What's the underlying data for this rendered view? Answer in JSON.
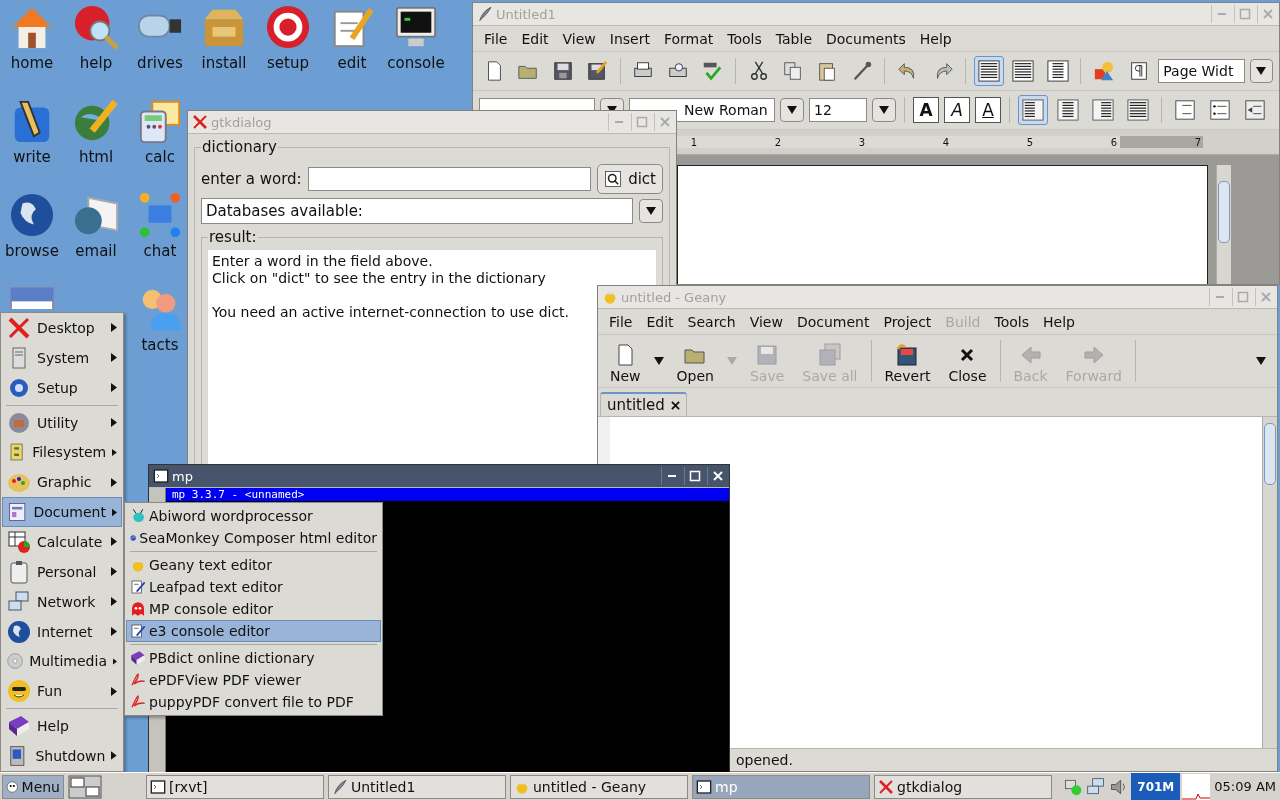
{
  "desktop": {
    "rows": [
      [
        {
          "label": "home",
          "kind": "house"
        },
        {
          "label": "help",
          "kind": "help"
        },
        {
          "label": "drives",
          "kind": "usb"
        },
        {
          "label": "install",
          "kind": "package"
        },
        {
          "label": "setup",
          "kind": "setup"
        },
        {
          "label": "edit",
          "kind": "notepad"
        },
        {
          "label": "console",
          "kind": "monitor"
        }
      ],
      [
        {
          "label": "write",
          "kind": "pen"
        },
        {
          "label": "html",
          "kind": "globe-pencil"
        },
        {
          "label": "calc",
          "kind": "calculator"
        }
      ],
      [
        {
          "label": "browse",
          "kind": "globe"
        },
        {
          "label": "email",
          "kind": "envelope"
        },
        {
          "label": "chat",
          "kind": "chat"
        }
      ],
      [
        {
          "kind": "calendar"
        },
        {},
        {
          "label": "tacts",
          "kind": "people"
        }
      ]
    ]
  },
  "abiword": {
    "title": "Untitled1",
    "active": false,
    "menus": [
      "File",
      "Edit",
      "View",
      "Insert",
      "Format",
      "Tools",
      "Table",
      "Documents",
      "Help"
    ],
    "zoom": "Page Widt",
    "font": "New Roman",
    "size": "12",
    "styles": [
      {
        "label": "A",
        "kind": "bold"
      },
      {
        "label": "A",
        "kind": "italic"
      },
      {
        "label": "A",
        "kind": "underline"
      }
    ],
    "view_modes": [
      {
        "selected": true
      },
      {
        "selected": false
      },
      {
        "selected": false
      }
    ],
    "alignments": [
      {
        "selected": true
      },
      {
        "selected": false
      },
      {
        "selected": false
      },
      {
        "selected": false
      }
    ],
    "ruler": [
      "1",
      "2",
      "3",
      "4",
      "5",
      "6",
      "7"
    ]
  },
  "dialog": {
    "title": "gtkdialog",
    "active": false,
    "frame": "dictionary",
    "word_label": "enter a word:",
    "button": "dict",
    "databases": "Databases available:",
    "result_label": "result:",
    "result_text": "Enter a word in the field above.\nClick on \"dict\" to see the entry in the dictionary\n\nYou need an active internet-connection to use dict."
  },
  "geany": {
    "title": "untitled - Geany",
    "active": false,
    "menus": [
      {
        "label": "File",
        "disabled": false
      },
      {
        "label": "Edit",
        "disabled": false
      },
      {
        "label": "Search",
        "disabled": false
      },
      {
        "label": "View",
        "disabled": false
      },
      {
        "label": "Document",
        "disabled": false
      },
      {
        "label": "Project",
        "disabled": false
      },
      {
        "label": "Build",
        "disabled": true
      },
      {
        "label": "Tools",
        "disabled": false
      },
      {
        "label": "Help",
        "disabled": false
      }
    ],
    "toolbar": [
      [
        {
          "label": "New",
          "kind": "new",
          "disabled": false,
          "dropdown": true,
          "dropdown_disabled": false
        },
        {
          "label": "Open",
          "kind": "open",
          "disabled": false,
          "dropdown": true,
          "dropdown_disabled": true
        },
        {
          "label": "Save",
          "kind": "save",
          "disabled": true
        },
        {
          "label": "Save all",
          "kind": "save-all",
          "disabled": true
        }
      ],
      [
        {
          "label": "Revert",
          "kind": "revert",
          "disabled": false
        },
        {
          "label": "Close",
          "kind": "close",
          "disabled": false
        }
      ],
      [
        {
          "label": "Back",
          "kind": "back",
          "disabled": true
        },
        {
          "label": "Forward",
          "kind": "forward",
          "disabled": true
        }
      ]
    ],
    "tabs": [
      {
        "label": "untitled",
        "selected": true
      }
    ],
    "status": "opened."
  },
  "mp": {
    "title": "mp",
    "active": true,
    "status_line": "mp 3.3.7 - <unnamed>"
  },
  "start_menu": {
    "groups": [
      [
        {
          "label": "Desktop",
          "kind": "x",
          "has_submenu": true,
          "selected": false
        },
        {
          "label": "System",
          "kind": "tower",
          "has_submenu": true,
          "selected": false
        },
        {
          "label": "Setup",
          "kind": "gears",
          "has_submenu": true,
          "selected": false
        }
      ],
      [
        {
          "label": "Utility",
          "kind": "toolbox",
          "has_submenu": true,
          "selected": false
        },
        {
          "label": "Filesystem",
          "kind": "cabinet",
          "has_submenu": true,
          "selected": false
        },
        {
          "label": "Graphic",
          "kind": "palette",
          "has_submenu": true,
          "selected": false
        },
        {
          "label": "Document",
          "kind": "document",
          "has_submenu": true,
          "selected": true
        },
        {
          "label": "Calculate",
          "kind": "spreadsheet",
          "has_submenu": true,
          "selected": false
        },
        {
          "label": "Personal",
          "kind": "clipboard",
          "has_submenu": true,
          "selected": false
        },
        {
          "label": "Network",
          "kind": "network",
          "has_submenu": true,
          "selected": false
        },
        {
          "label": "Internet",
          "kind": "globe",
          "has_submenu": true,
          "selected": false
        },
        {
          "label": "Multimedia",
          "kind": "disc",
          "has_submenu": true,
          "selected": false
        },
        {
          "label": "Fun",
          "kind": "smiley",
          "has_submenu": true,
          "selected": false
        }
      ],
      [
        {
          "label": "Help",
          "kind": "book",
          "has_submenu": false,
          "selected": false
        },
        {
          "label": "Shutdown",
          "kind": "power",
          "has_submenu": true,
          "selected": false
        }
      ]
    ]
  },
  "submenu": {
    "groups": [
      [
        {
          "label": "Abiword wordprocessor",
          "kind": "bug",
          "selected": false
        },
        {
          "label": "SeaMonkey Composer html editor",
          "kind": "swirl",
          "selected": false
        }
      ],
      [
        {
          "label": "Geany text editor",
          "kind": "genie",
          "selected": false
        },
        {
          "label": "Leafpad text editor",
          "kind": "edit",
          "selected": false
        },
        {
          "label": "MP console editor",
          "kind": "ghost",
          "selected": false
        },
        {
          "label": "e3 console editor",
          "kind": "edit",
          "selected": true
        }
      ],
      [
        {
          "label": "PBdict online dictionary",
          "kind": "book",
          "selected": false
        },
        {
          "label": "ePDFView PDF viewer",
          "kind": "pdf",
          "selected": false
        },
        {
          "label": "puppyPDF convert file to PDF",
          "kind": "pdf",
          "selected": false
        }
      ]
    ]
  },
  "taskbar": {
    "menu_button": "Menu",
    "tasks": [
      {
        "label": "[rxvt]",
        "kind": "terminal",
        "selected": false
      },
      {
        "label": "Untitled1",
        "kind": "quill",
        "selected": false
      },
      {
        "label": "untitled - Geany",
        "kind": "genie",
        "selected": false
      },
      {
        "label": "mp",
        "kind": "terminal",
        "selected": true
      },
      {
        "label": "gtkdialog",
        "kind": "x",
        "selected": false
      }
    ],
    "memory": "701M",
    "clock": "05:09 AM"
  }
}
